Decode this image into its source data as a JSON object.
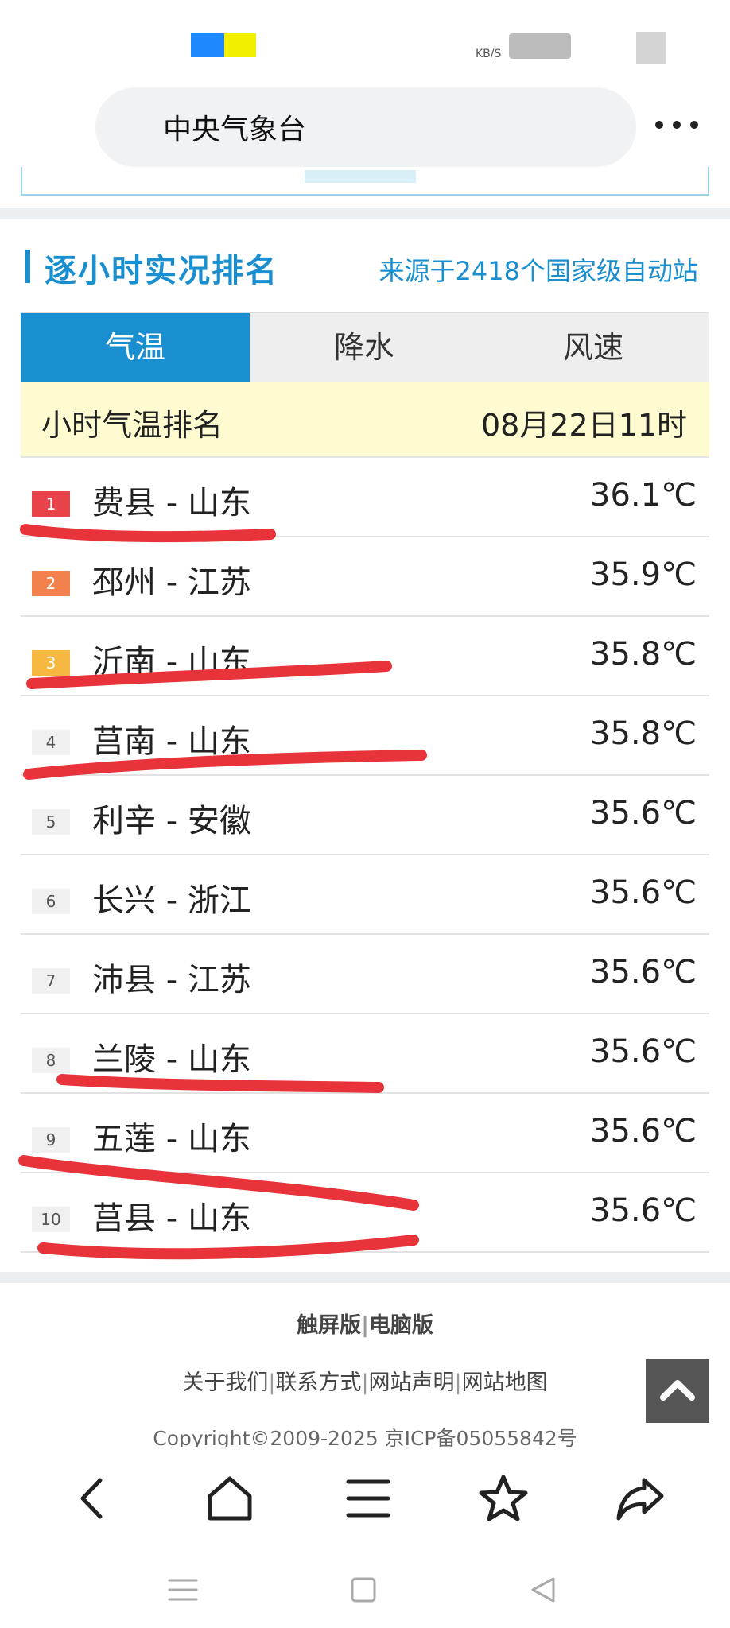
{
  "status_bar": {
    "speed_unit": "KB/S"
  },
  "address_bar": {
    "url_title": "中央气象台",
    "more_icon": "more-horizontal-icon"
  },
  "section": {
    "title": "逐小时实况排名",
    "source": "来源于2418个国家级自动站"
  },
  "tabs": [
    {
      "label": "气温",
      "active": true
    },
    {
      "label": "降水",
      "active": false
    },
    {
      "label": "风速",
      "active": false
    }
  ],
  "subtitle": {
    "left": "小时气温排名",
    "right": "08月22日11时"
  },
  "rankings": [
    {
      "rank": "1",
      "name": "费县 - 山东",
      "value": "36.1℃"
    },
    {
      "rank": "2",
      "name": "邳州 - 江苏",
      "value": "35.9℃"
    },
    {
      "rank": "3",
      "name": "沂南 - 山东",
      "value": "35.8℃"
    },
    {
      "rank": "4",
      "name": "莒南 - 山东",
      "value": "35.8℃"
    },
    {
      "rank": "5",
      "name": "利辛 - 安徽",
      "value": "35.6℃"
    },
    {
      "rank": "6",
      "name": "长兴 - 浙江",
      "value": "35.6℃"
    },
    {
      "rank": "7",
      "name": "沛县 - 江苏",
      "value": "35.6℃"
    },
    {
      "rank": "8",
      "name": "兰陵 - 山东",
      "value": "35.6℃"
    },
    {
      "rank": "9",
      "name": "五莲 - 山东",
      "value": "35.6℃"
    },
    {
      "rank": "10",
      "name": "莒县 - 山东",
      "value": "35.6℃"
    }
  ],
  "colors": {
    "accent": "#1a8fd0",
    "rank1": "#e8434a",
    "rank2": "#f2814e",
    "rank3": "#f7b841",
    "annotation": "#e8333a"
  },
  "footer": {
    "touch_version": "触屏版",
    "separator": "|",
    "pc_version": "电脑版",
    "links": [
      "关于我们",
      "联系方式",
      "网站声明",
      "网站地图"
    ],
    "copyright": "Copyright©2009-2025 京ICP备05055842号",
    "back_to_top_icon": "chevron-up-icon"
  },
  "browser_toolbar": {
    "icons": [
      "back-icon",
      "home-icon",
      "menu-icon",
      "star-icon",
      "share-icon"
    ]
  },
  "system_nav": {
    "icons": [
      "recent-apps-icon",
      "home-square-icon",
      "back-triangle-icon"
    ]
  }
}
